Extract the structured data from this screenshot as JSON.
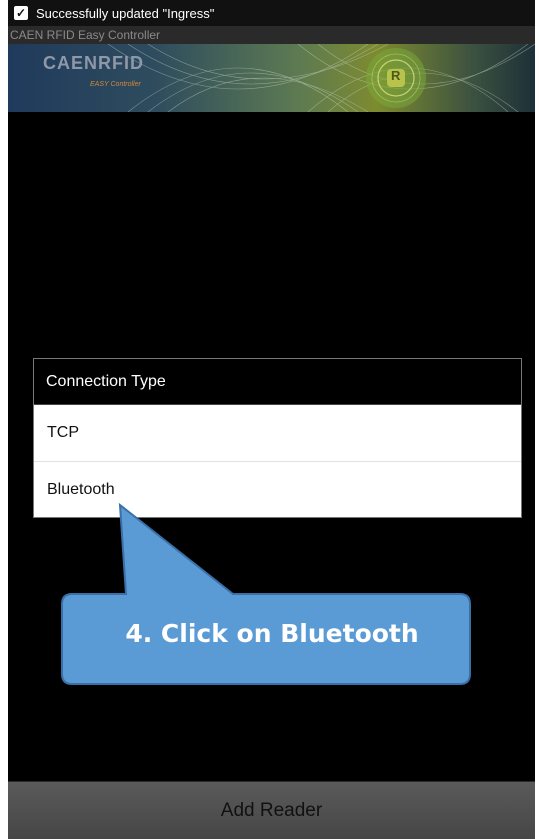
{
  "status_bar": {
    "notification": "Successfully updated \"Ingress\"",
    "icon": "checkbox-icon"
  },
  "app": {
    "title": "CAEN RFID Easy Controller"
  },
  "banner": {
    "logo_text": "CAENRFID",
    "subtitle": "EASY Controller",
    "badge": "R"
  },
  "dialog": {
    "title": "Connection Type",
    "options": [
      "TCP",
      "Bluetooth"
    ]
  },
  "callout": {
    "text": "4. Click on Bluetooth",
    "color": "#5b9bd5"
  },
  "footer": {
    "add_reader_label": "Add Reader"
  }
}
